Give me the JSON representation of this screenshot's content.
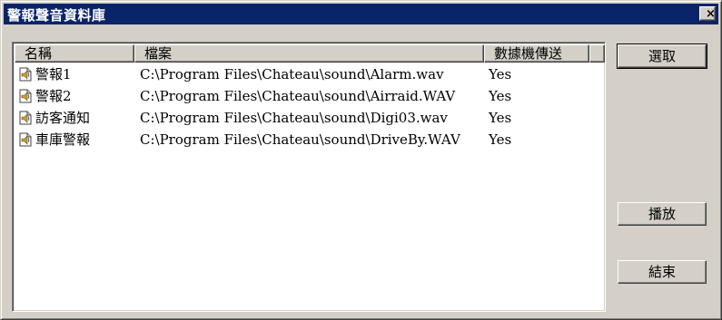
{
  "window": {
    "title": "警報聲音資料庫",
    "close_label": "×"
  },
  "list": {
    "columns": [
      "名稱",
      "檔案",
      "數據機傳送"
    ],
    "rows": [
      {
        "name": "警報1",
        "file": "C:\\Program Files\\Chateau\\sound\\Alarm.wav",
        "send": "Yes",
        "icon": "sound-file-icon"
      },
      {
        "name": "警報2",
        "file": "C:\\Program Files\\Chateau\\sound\\Airraid.WAV",
        "send": "Yes",
        "icon": "sound-file-icon"
      },
      {
        "name": "訪客通知",
        "file": "C:\\Program Files\\Chateau\\sound\\Digi03.wav",
        "send": "Yes",
        "icon": "sound-file-icon"
      },
      {
        "name": "車庫警報",
        "file": "C:\\Program Files\\Chateau\\sound\\DriveBy.WAV",
        "send": "Yes",
        "icon": "sound-file-icon"
      }
    ]
  },
  "buttons": {
    "select": "選取",
    "play": "播放",
    "close": "結束"
  },
  "colors": {
    "titlebar": "#0a246a",
    "face": "#d4d0c8",
    "list_bg": "#ffffff"
  }
}
